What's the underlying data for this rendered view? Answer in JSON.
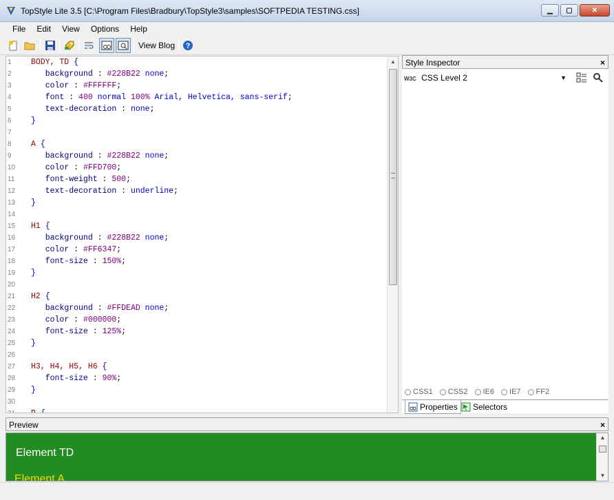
{
  "window": {
    "title": "TopStyle Lite 3.5 [C:\\Program Files\\Bradbury\\TopStyle3\\samples\\SOFTPEDIA TESTING.css]",
    "min_icon": "minimize-icon",
    "max_icon": "maximize-icon",
    "close_icon": "close-icon"
  },
  "menu": {
    "items": [
      {
        "label": "File"
      },
      {
        "label": "Edit"
      },
      {
        "label": "View"
      },
      {
        "label": "Options"
      },
      {
        "label": "Help"
      }
    ]
  },
  "toolbar": {
    "view_blog_label": "View Blog",
    "icons": [
      "new-file-icon",
      "open-folder-icon",
      "save-icon",
      "tag-icon",
      "word-wrap-icon",
      "preview-split-icon",
      "preview-zoom-icon",
      "help-icon"
    ]
  },
  "editor": {
    "lines": [
      {
        "n": "1",
        "selector": "BODY, TD",
        "brace": "{"
      },
      {
        "n": "2",
        "prop": "background",
        "value": "#228B22",
        "extra": "none"
      },
      {
        "n": "3",
        "prop": "color",
        "value": "#FFFFFF"
      },
      {
        "n": "4",
        "prop": "font",
        "value": "400",
        "extra": "normal",
        "value2": "100%",
        "extra2": "Arial, Helvetica, sans-serif"
      },
      {
        "n": "5",
        "prop": "text-decoration",
        "extra": "none"
      },
      {
        "n": "6",
        "close": "}"
      },
      {
        "n": "7"
      },
      {
        "n": "8",
        "selector": "A",
        "brace": "{"
      },
      {
        "n": "9",
        "prop": "background",
        "value": "#228B22",
        "extra": "none"
      },
      {
        "n": "10",
        "prop": "color",
        "value": "#FFD700"
      },
      {
        "n": "11",
        "prop": "font-weight",
        "value": "500"
      },
      {
        "n": "12",
        "prop": "text-decoration",
        "extra": "underline"
      },
      {
        "n": "13",
        "close": "}"
      },
      {
        "n": "14"
      },
      {
        "n": "15",
        "selector": "H1",
        "brace": "{"
      },
      {
        "n": "16",
        "prop": "background",
        "value": "#228B22",
        "extra": "none"
      },
      {
        "n": "17",
        "prop": "color",
        "value": "#FF6347"
      },
      {
        "n": "18",
        "prop": "font-size",
        "value": "150%"
      },
      {
        "n": "19",
        "close": "}"
      },
      {
        "n": "20"
      },
      {
        "n": "21",
        "selector": "H2",
        "brace": "{"
      },
      {
        "n": "22",
        "prop": "background",
        "value": "#FFDEAD",
        "extra": "none"
      },
      {
        "n": "23",
        "prop": "color",
        "value": "#000000"
      },
      {
        "n": "24",
        "prop": "font-size",
        "value": "125%"
      },
      {
        "n": "25",
        "close": "}"
      },
      {
        "n": "26"
      },
      {
        "n": "27",
        "selector": "H3, H4, H5, H6",
        "brace": "{"
      },
      {
        "n": "28",
        "prop": "font-size",
        "value": "90%"
      },
      {
        "n": "29",
        "close": "}"
      },
      {
        "n": "30"
      },
      {
        "n": "31",
        "selector": "P",
        "brace": "{"
      }
    ]
  },
  "inspector": {
    "title": "Style Inspector",
    "close": "×",
    "w3c_badge": "W3C",
    "level": "CSS Level 2",
    "radios": [
      "CSS1",
      "CSS2",
      "IE6",
      "IE7",
      "FF2"
    ],
    "tabs": [
      {
        "label": "Properties",
        "icon": "properties-icon"
      },
      {
        "label": "Selectors",
        "icon": "selectors-icon"
      }
    ]
  },
  "preview": {
    "title": "Preview",
    "close": "×",
    "element_td": "Element TD",
    "element_a": "Element A",
    "bg_color": "#228B22",
    "td_color": "#FFFFFF",
    "a_color": "#FFD700"
  }
}
